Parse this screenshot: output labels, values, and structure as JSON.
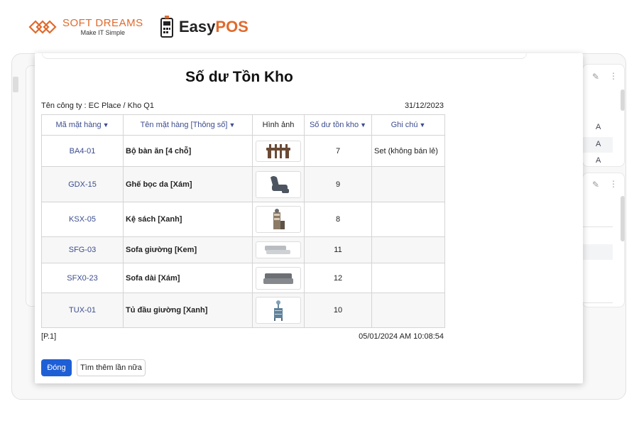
{
  "brand": {
    "softdreams_name": "SOFT DREAMS",
    "softdreams_tagline": "Make IT Simple",
    "easypos_prefix": "Easy",
    "easypos_suffix": "POS",
    "accent_color": "#e06a2c"
  },
  "report": {
    "title": "Số dư Tồn Kho",
    "company_line": "Tên công ty : EC Place / Kho Q1",
    "date": "31/12/2023",
    "columns": [
      {
        "label": "Mã mặt hàng",
        "sortable": true
      },
      {
        "label": "Tên mặt hàng [Thông số]",
        "sortable": true
      },
      {
        "label": "Hình ảnh",
        "sortable": false
      },
      {
        "label": "Số dư tồn kho",
        "sortable": true
      },
      {
        "label": "Ghi chú",
        "sortable": true
      }
    ],
    "rows": [
      {
        "code": "BA4-01",
        "name": "Bộ bàn ăn [4 chỗ]",
        "image": "dining-set-icon",
        "qty": "7",
        "note": "Set (không bán lẻ)"
      },
      {
        "code": "GDX-15",
        "name": "Ghế bọc da [Xám]",
        "image": "recliner-chair-icon",
        "qty": "9",
        "note": ""
      },
      {
        "code": "KSX-05",
        "name": "Kệ sách [Xanh]",
        "image": "bookshelf-icon",
        "qty": "8",
        "note": ""
      },
      {
        "code": "SFG-03",
        "name": "Sofa giường [Kem]",
        "image": "sofa-bed-icon",
        "qty": "11",
        "note": ""
      },
      {
        "code": "SFX0-23",
        "name": "Sofa dài [Xám]",
        "image": "long-sofa-icon",
        "qty": "12",
        "note": ""
      },
      {
        "code": "TUX-01",
        "name": "Tủ đầu giường [Xanh]",
        "image": "nightstand-icon",
        "qty": "10",
        "note": ""
      }
    ],
    "page": "[P.1]",
    "printed_at": "05/01/2024 AM 10:08:54"
  },
  "actions": {
    "close_label": "Đóng",
    "search_again_label": "Tìm thêm lần nữa",
    "primary_color": "#1f5fd6"
  },
  "background": {
    "letters": [
      "A",
      "A",
      "A"
    ]
  }
}
